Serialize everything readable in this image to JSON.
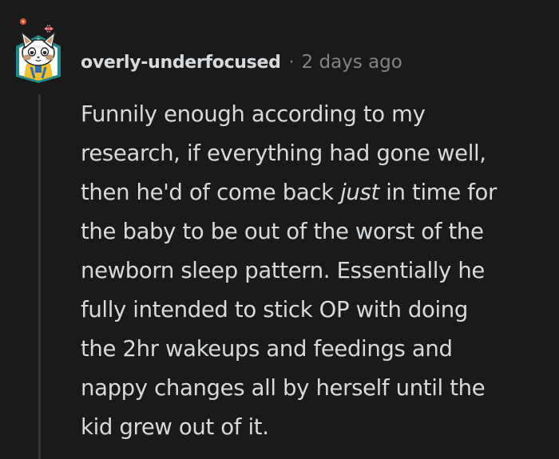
{
  "comment": {
    "author": "overly-underfocused",
    "separator": "·",
    "timestamp": "2 days ago",
    "body_lines": [
      "Funnily enough according to my",
      "research, if everything had gone well,",
      [
        "then he'd of come back ",
        "just",
        " in time for"
      ],
      "the baby to be out of the worst of the",
      "newborn sleep pattern. Essentially he",
      "fully intended to stick OP with doing",
      "the 2hr wakeups and feedings and",
      "nappy changes all by herself until the",
      "kid grew out of it."
    ]
  },
  "colors": {
    "background": "#1a1a1b",
    "text": "#d7dadc",
    "meta": "#818384",
    "thread_line": "#343536",
    "avatar_frame": "#1e8a8a"
  },
  "icons": {
    "avatar": "cat-avatar-icon"
  }
}
